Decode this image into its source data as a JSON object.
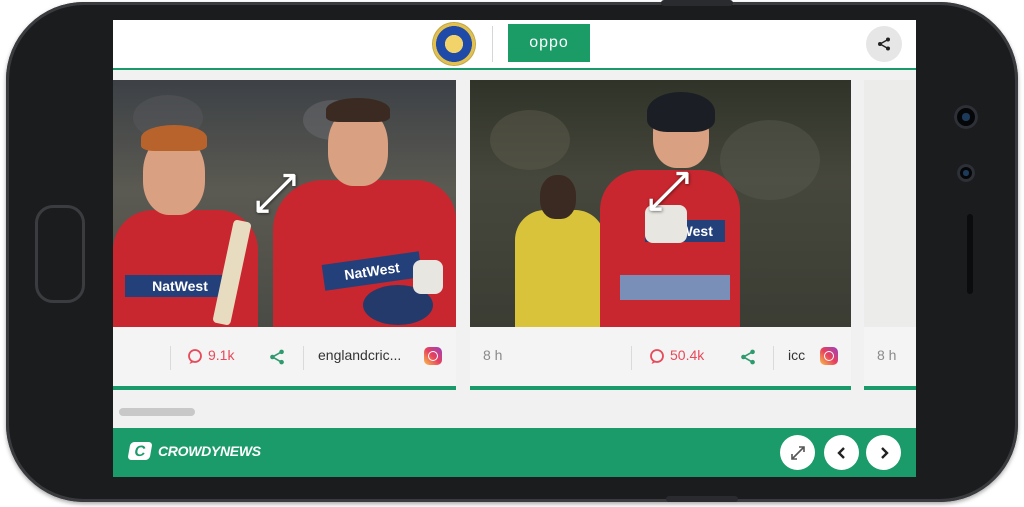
{
  "header": {
    "sponsor_label": "oppo",
    "share_icon": "share-icon"
  },
  "cards": [
    {
      "comments": "9.1k",
      "username": "englandcric...",
      "source_icon": "instagram-icon"
    },
    {
      "time": "8 h",
      "comments": "50.4k",
      "username": "icc",
      "source_icon": "instagram-icon"
    },
    {
      "time": "8 h"
    }
  ],
  "footer": {
    "brand_mark": "C",
    "brand_name": "CROWDYNEWS",
    "buttons": [
      "expand-icon",
      "chevron-left-icon",
      "chevron-right-icon"
    ]
  },
  "colors": {
    "accent": "#1b9b6a",
    "comment": "#e74a5a",
    "jersey": "#c9272f"
  }
}
